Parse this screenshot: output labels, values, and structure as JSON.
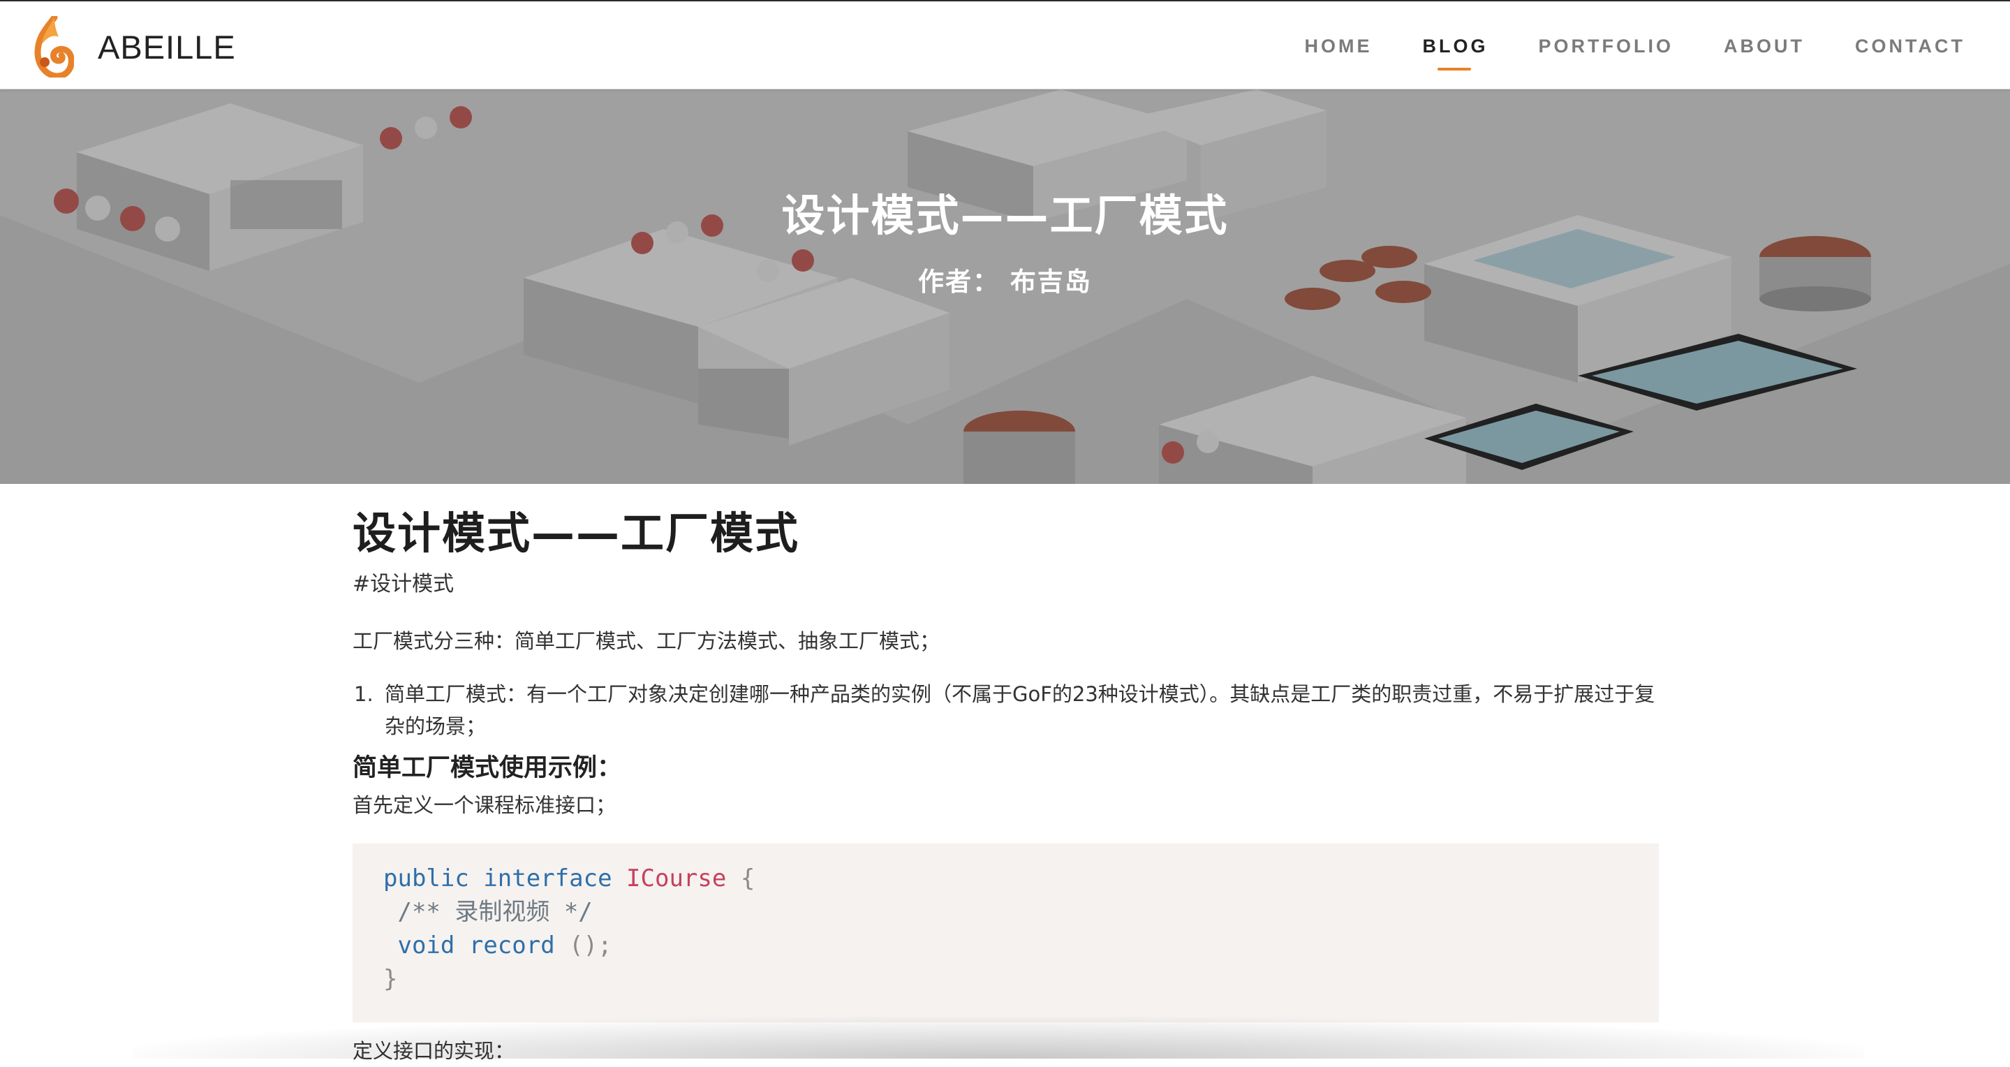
{
  "brand": {
    "name": "ABEILLE"
  },
  "nav": {
    "items": [
      {
        "label": "HOME",
        "active": false
      },
      {
        "label": "BLOG",
        "active": true
      },
      {
        "label": "PORTFOLIO",
        "active": false
      },
      {
        "label": "ABOUT",
        "active": false
      },
      {
        "label": "CONTACT",
        "active": false
      }
    ]
  },
  "hero": {
    "title": "设计模式——工厂模式",
    "author": "作者： 布吉岛"
  },
  "article": {
    "title": "设计模式——工厂模式",
    "tag": "#设计模式",
    "intro": "工厂模式分三种：简单工厂模式、工厂方法模式、抽象工厂模式；",
    "list": [
      {
        "number": "1.",
        "text": "简单工厂模式：有一个工厂对象决定创建哪一种产品类的实例（不属于GoF的23种设计模式）。其缺点是工厂类的职责过重，不易于扩展过于复杂的场景；"
      }
    ],
    "subheading": "简单工厂模式使用示例：",
    "subtext": "首先定义一个课程标准接口；",
    "code": {
      "line1": {
        "kw1": "public",
        "kw2": "interface",
        "cls": "ICourse",
        "brace": "{"
      },
      "line2": {
        "comment": "/** 录制视频 */"
      },
      "line3": {
        "kw": "void",
        "name": "record",
        "parens": "();"
      },
      "line4": {
        "brace": "}"
      }
    },
    "next_line": "定义接口的实现："
  },
  "colors": {
    "accent": "#e8822a",
    "code_bg": "#f5f2f0",
    "code_keyword": "#2f6fa8",
    "code_class": "#c8405c"
  }
}
